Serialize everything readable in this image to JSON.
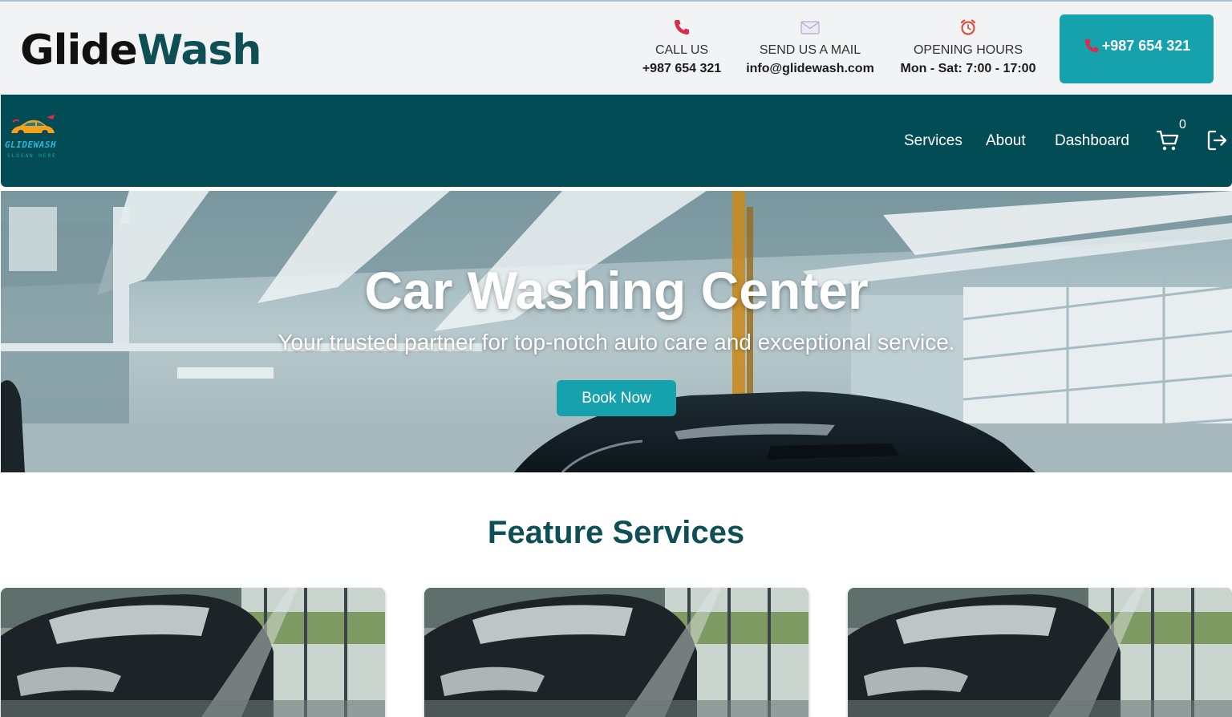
{
  "brand": {
    "part1": "Glide",
    "part2": "Wash"
  },
  "contact": {
    "call": {
      "label": "CALL US",
      "value": "+987 654 321",
      "icon": "phone-icon"
    },
    "mail": {
      "label": "SEND US A MAIL",
      "value": "info@glidewash.com",
      "icon": "envelope-icon"
    },
    "hours": {
      "label": "OPENING HOURS",
      "value": "Mon - Sat: 7:00 - 17:00",
      "icon": "alarm-clock-icon"
    },
    "button_label": "+987 654 321"
  },
  "nav": {
    "logo_text": "GLIDEWASH",
    "logo_slogan": "SLOGAN HERE",
    "links": [
      "Services",
      "About",
      "Dashboard"
    ],
    "cart_count": "0",
    "icons": [
      "cart-icon",
      "logout-icon"
    ]
  },
  "hero": {
    "title": "Car Washing Center",
    "subtitle": "Your trusted partner for top-notch auto care and exceptional service.",
    "cta": "Book Now"
  },
  "features": {
    "title": "Feature Services",
    "cards": [
      {
        "image": "car-foam-wash"
      },
      {
        "image": "car-foam-wash"
      },
      {
        "image": "car-foam-wash"
      }
    ]
  },
  "colors": {
    "brand_dark": "#024d55",
    "accent": "#15a2ad",
    "topbar_bg": "#f2f3f5",
    "phone_red": "#e0284a"
  }
}
